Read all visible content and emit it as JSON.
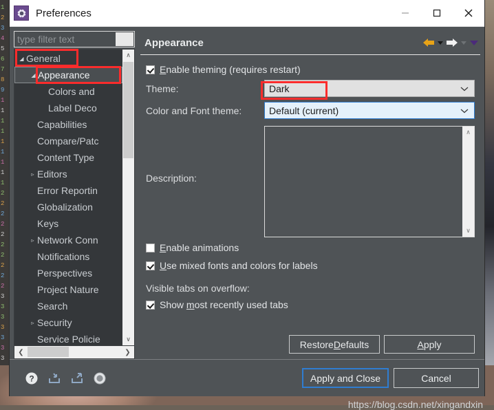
{
  "window": {
    "title": "Preferences",
    "icon": "gear-icon",
    "minimize_label": "—",
    "maximize_label": "□",
    "close_label": "✕"
  },
  "filter": {
    "placeholder": "type filter text",
    "value": ""
  },
  "tree": {
    "items": [
      {
        "label": "General",
        "indent": 0,
        "twisty": "expanded",
        "selected": false
      },
      {
        "label": "Appearance",
        "indent": 1,
        "twisty": "expanded",
        "selected": true
      },
      {
        "label": "Colors and",
        "indent": 2,
        "twisty": "none",
        "selected": false
      },
      {
        "label": "Label Deco",
        "indent": 2,
        "twisty": "none",
        "selected": false
      },
      {
        "label": "Capabilities",
        "indent": 1,
        "twisty": "none",
        "selected": false
      },
      {
        "label": "Compare/Patc",
        "indent": 1,
        "twisty": "none",
        "selected": false
      },
      {
        "label": "Content Type",
        "indent": 1,
        "twisty": "none",
        "selected": false
      },
      {
        "label": "Editors",
        "indent": 1,
        "twisty": "collapsed",
        "selected": false
      },
      {
        "label": "Error Reportin",
        "indent": 1,
        "twisty": "none",
        "selected": false
      },
      {
        "label": "Globalization",
        "indent": 1,
        "twisty": "none",
        "selected": false
      },
      {
        "label": "Keys",
        "indent": 1,
        "twisty": "none",
        "selected": false
      },
      {
        "label": "Network Conn",
        "indent": 1,
        "twisty": "collapsed",
        "selected": false
      },
      {
        "label": "Notifications",
        "indent": 1,
        "twisty": "none",
        "selected": false
      },
      {
        "label": "Perspectives",
        "indent": 1,
        "twisty": "none",
        "selected": false
      },
      {
        "label": "Project Nature",
        "indent": 1,
        "twisty": "none",
        "selected": false
      },
      {
        "label": "Search",
        "indent": 1,
        "twisty": "none",
        "selected": false
      },
      {
        "label": "Security",
        "indent": 1,
        "twisty": "collapsed",
        "selected": false
      },
      {
        "label": "Service Policie",
        "indent": 1,
        "twisty": "none",
        "selected": false
      }
    ],
    "scroll_up": "∧",
    "scroll_down": "∨",
    "scroll_left": "❮",
    "scroll_right": "❯"
  },
  "page": {
    "title": "Appearance",
    "nav": {
      "back": "back-arrow-icon",
      "back_menu": "chevron-down-icon",
      "forward": "forward-arrow-icon",
      "forward_menu": "chevron-down-icon",
      "view_menu": "view-menu-icon"
    },
    "enable_theming": {
      "label": "Enable theming (requires restart)",
      "mnemonic": "E",
      "checked": true
    },
    "theme": {
      "label": "Theme:",
      "value": "Dark"
    },
    "color_font_theme": {
      "label": "Color and Font theme:",
      "value": "Default (current)"
    },
    "description": {
      "label": "Description:",
      "value": ""
    },
    "enable_animations": {
      "label": "Enable animations",
      "mnemonic": "E",
      "checked": false
    },
    "mixed_fonts": {
      "label": "Use mixed fonts and colors for labels",
      "mnemonic": "U",
      "checked": true
    },
    "visible_tabs_label": "Visible tabs on overflow:",
    "show_mru": {
      "label": "Show most recently used tabs",
      "mnemonic": "m",
      "checked": true
    },
    "restore_defaults_label": "Restore Defaults",
    "apply_label": "Apply"
  },
  "footer": {
    "icons": [
      {
        "name": "help-icon",
        "glyph": "?"
      },
      {
        "name": "import-icon",
        "glyph": "import"
      },
      {
        "name": "export-icon",
        "glyph": "export"
      },
      {
        "name": "settings-icon",
        "glyph": "circle"
      }
    ],
    "apply_and_close_label": "Apply and Close",
    "cancel_label": "Cancel"
  },
  "watermark": "https://blog.csdn.net/xingandxin",
  "background": {
    "code_lines": [
      "1",
      "2",
      "3",
      "4",
      "5",
      "6",
      "7",
      "8",
      "9",
      "1",
      "1",
      "1",
      "1",
      "1",
      "1",
      "1",
      "1",
      "1",
      "2",
      "2",
      "2",
      "2",
      "2",
      "2",
      "2",
      "2",
      "2",
      "2",
      "3",
      "3",
      "3",
      "3",
      "3",
      "3",
      "3"
    ]
  },
  "colors": {
    "dialog_bg": "#4f5356",
    "tree_bg": "#34373a",
    "accent_blue": "#2f7dd1",
    "annotation_red": "#fb2c2c",
    "title_icon_purple": "#6a4b8f",
    "back_arrow_gold": "#e8a317"
  }
}
